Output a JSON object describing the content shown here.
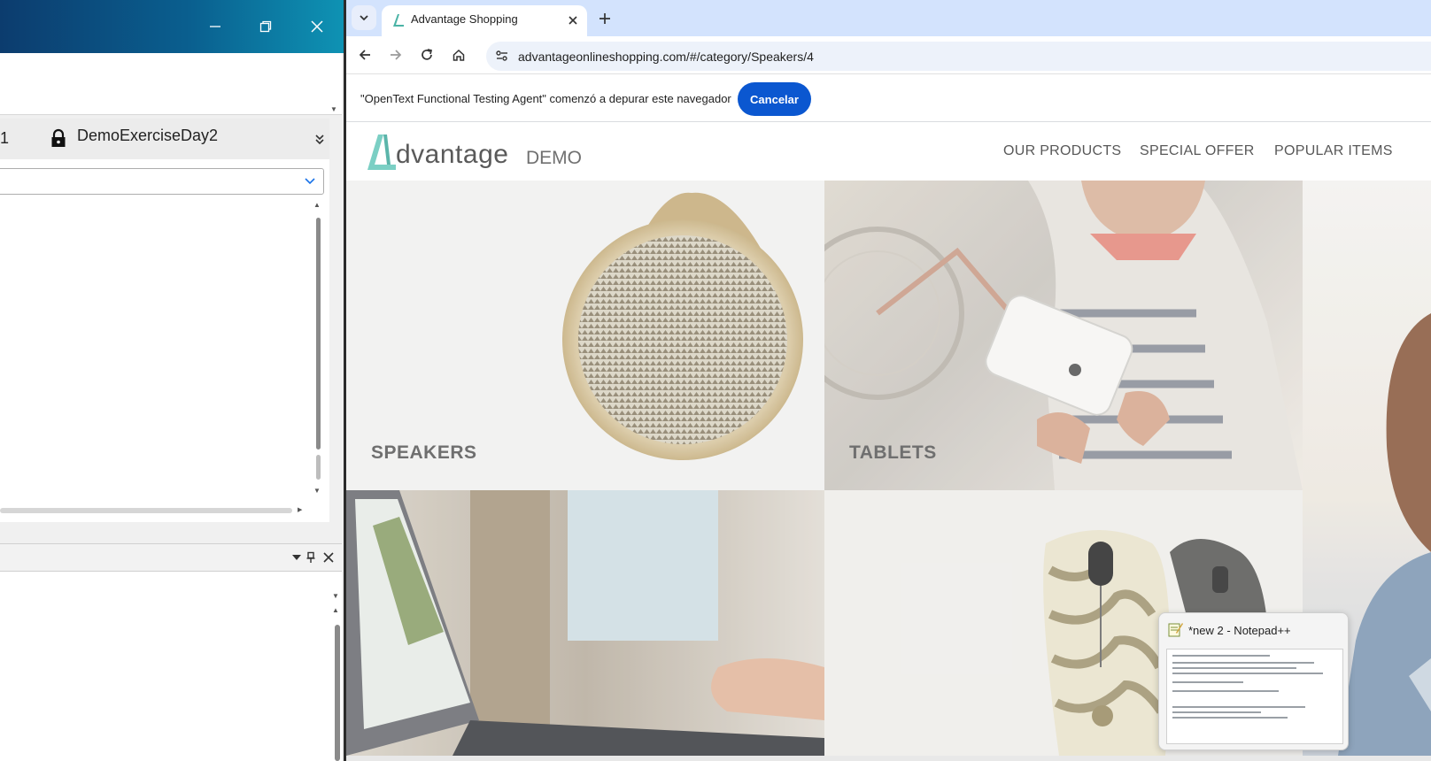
{
  "left_app": {
    "tab_left_text": "1",
    "tab_name": "DemoExerciseDay2"
  },
  "browser": {
    "tab_title": "Advantage Shopping",
    "url": "advantageonlineshopping.com/#/category/Speakers/4",
    "infobar_message": "\"OpenText Functional Testing Agent\" comenzó a depurar este navegador",
    "cancel_label": "Cancelar"
  },
  "site": {
    "logo_word": "dvantage",
    "logo_demo": "DEMO",
    "menu": [
      "OUR PRODUCTS",
      "SPECIAL OFFER",
      "POPULAR ITEMS"
    ],
    "tiles": [
      {
        "label": "SPEAKERS"
      },
      {
        "label": "TABLETS"
      }
    ]
  },
  "taskbar_preview": {
    "title": "*new 2 - Notepad++"
  },
  "colors": {
    "accent_blue": "#0b57d0",
    "logo_teal": "#7bcfc4",
    "titlebar_start": "#0c3c6e",
    "titlebar_end": "#0e93b4"
  }
}
